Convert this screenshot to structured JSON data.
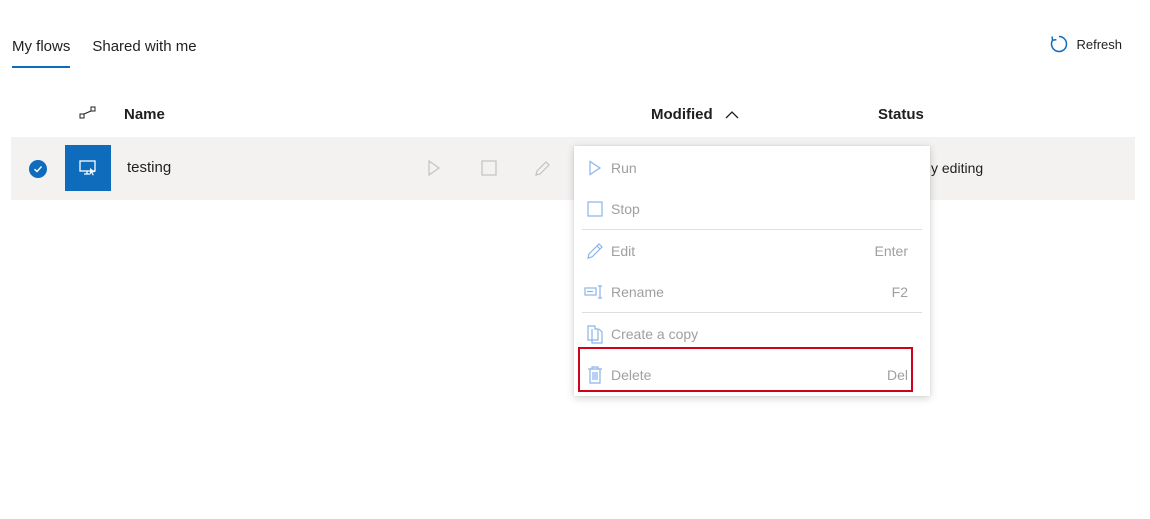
{
  "tabs": [
    {
      "label": "My flows",
      "active": true
    },
    {
      "label": "Shared with me",
      "active": false
    }
  ],
  "refresh_label": "Refresh",
  "table": {
    "headers": {
      "type_icon": "flow-type-icon",
      "name": "Name",
      "modified": "Modified",
      "status": "Status"
    },
    "rows": [
      {
        "name": "testing",
        "status_partial": "y editing",
        "selected": true
      }
    ]
  },
  "context_menu": {
    "items": [
      {
        "label": "Run",
        "shortcut": "",
        "icon": "play-icon"
      },
      {
        "label": "Stop",
        "shortcut": "",
        "icon": "stop-icon"
      },
      {
        "label": "Edit",
        "shortcut": "Enter",
        "icon": "pencil-icon"
      },
      {
        "label": "Rename",
        "shortcut": "F2",
        "icon": "rename-icon"
      },
      {
        "label": "Create a copy",
        "shortcut": "",
        "icon": "copy-icon"
      },
      {
        "label": "Delete",
        "shortcut": "Del",
        "icon": "trash-icon"
      }
    ]
  },
  "colors": {
    "accent": "#0f6cbd",
    "highlight": "#d0021b",
    "disabled_text": "#a19f9d"
  }
}
